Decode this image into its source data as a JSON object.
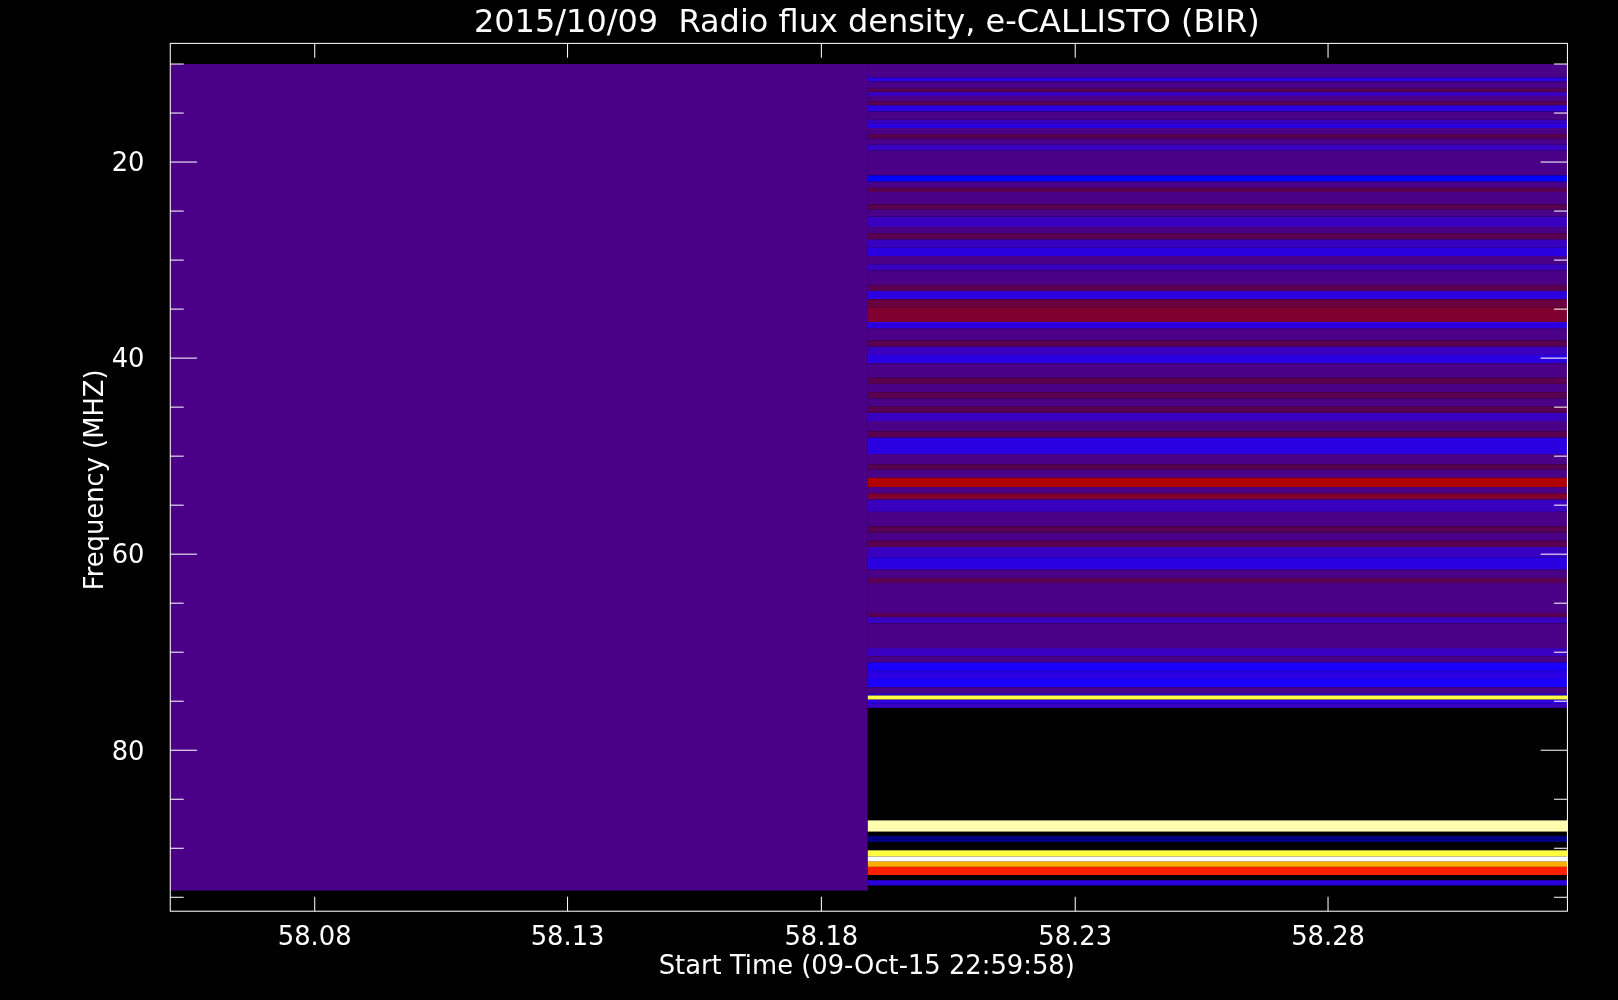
{
  "plot": {
    "title": "2015/10/09  Radio flux density, e-CALLISTO (BIR)",
    "xlabel": "Start Time (09-Oct-15 22:59:58)",
    "ylabel": "Frequency (MHZ)",
    "xtick_labels": [
      "58.08",
      "58.13",
      "58.18",
      "58.23",
      "58.28"
    ],
    "ytick_labels": [
      "20",
      "40",
      "60",
      "80"
    ]
  }
}
